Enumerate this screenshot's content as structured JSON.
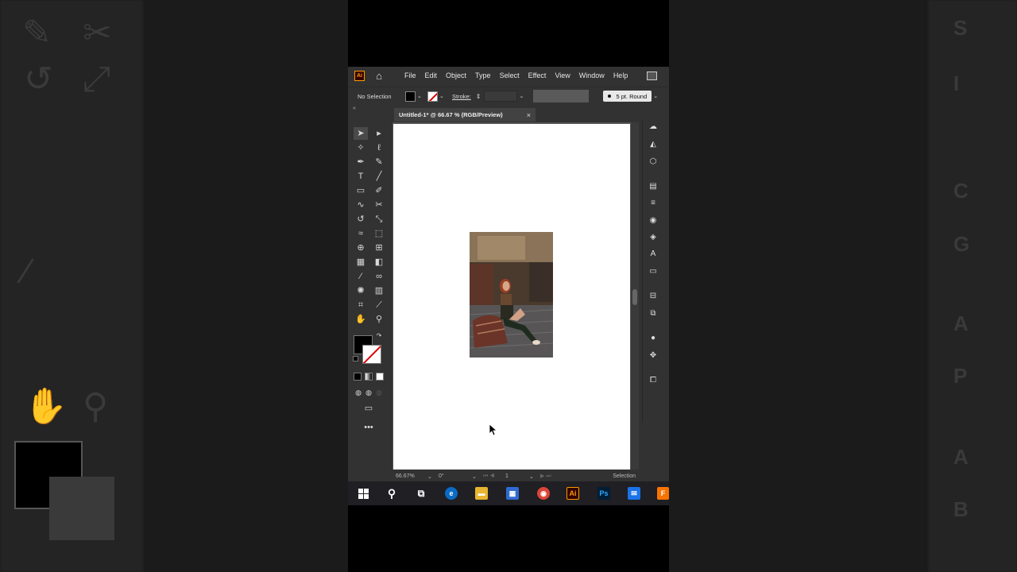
{
  "app": {
    "logo": "Ai",
    "menu": [
      "File",
      "Edit",
      "Object",
      "Type",
      "Select",
      "Effect",
      "View",
      "Window",
      "Help"
    ]
  },
  "control_bar": {
    "selection": "No Selection",
    "stroke_label": "Stroke:",
    "brush": "5 pt. Round"
  },
  "document": {
    "tab_title": "Untitled-1* @ 66.67 % (RGB/Preview)",
    "close": "×"
  },
  "status": {
    "zoom": "66.67%",
    "rotation": "0°",
    "artboard": "1",
    "tool": "Selection"
  },
  "taskbar": {
    "illustrator": "Ai",
    "photoshop": "Ps"
  },
  "colors": {
    "ai_logo": "#ff9a00",
    "fill": "#000000",
    "stroke_none": "#d00000",
    "ui_dark": "#323232",
    "artboard": "#ffffff"
  }
}
